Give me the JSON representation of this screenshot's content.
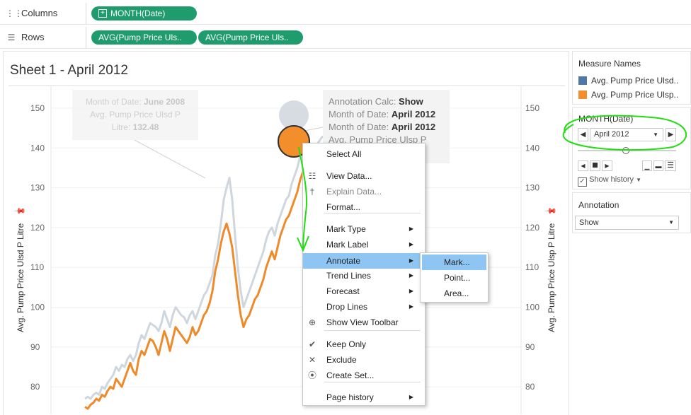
{
  "shelves": {
    "columns_label": "Columns",
    "rows_label": "Rows",
    "columns_pill": "MONTH(Date)",
    "rows_pills": [
      "AVG(Pump Price Uls..",
      "AVG(Pump Price Uls.."
    ]
  },
  "sheet": {
    "title": "Sheet 1 - April 2012",
    "left_axis_title": "Avg. Pump Price Ulsd P Litre",
    "right_axis_title": "Avg. Pump Price Ulsp P Litre",
    "y_ticks": [
      "150",
      "140",
      "130",
      "120",
      "110",
      "100",
      "90",
      "80"
    ]
  },
  "tooltip_faded": {
    "l1_label": "Month of Date:",
    "l1_value": "June 2008",
    "l2_label": "Avg. Pump Price Ulsd P",
    "l2_value": "",
    "l3_label": "Litre:",
    "l3_value": "132.48"
  },
  "tooltip_main": {
    "l1_label": "Annotation Calc:",
    "l1_value": "Show",
    "l2_label": "Month of Date:",
    "l2_value": "April 2012",
    "l3_label": "Month of Date:",
    "l3_value": "April 2012",
    "l4_label": "Avg. Pump Price Ulsp P",
    "l4_value": ""
  },
  "legend": {
    "title": "Measure Names",
    "items": [
      {
        "label": "Avg. Pump Price Ulsd..",
        "color": "#4e79a7"
      },
      {
        "label": "Avg. Pump Price Ulsp..",
        "color": "#f28e2b"
      }
    ]
  },
  "page_control": {
    "title": "MONTH(Date)",
    "value": "April 2012",
    "show_history_label": "Show history",
    "show_history_checked": true,
    "slider_level": 0.48
  },
  "annotation_filter": {
    "title": "Annotation",
    "value": "Show"
  },
  "context_menu": {
    "items": [
      {
        "label": "Select All",
        "icon": "",
        "submenu": false
      },
      {
        "label": "View Data...",
        "icon": "table-icon",
        "submenu": false
      },
      {
        "label": "Explain Data...",
        "icon": "lightbulb-icon",
        "submenu": false,
        "disabled": true
      },
      {
        "label": "Format...",
        "icon": "",
        "submenu": false
      },
      {
        "label": "Mark Type",
        "icon": "",
        "submenu": true
      },
      {
        "label": "Mark Label",
        "icon": "",
        "submenu": true
      },
      {
        "label": "Annotate",
        "icon": "",
        "submenu": true,
        "highlighted": true
      },
      {
        "label": "Trend Lines",
        "icon": "",
        "submenu": true
      },
      {
        "label": "Forecast",
        "icon": "",
        "submenu": true
      },
      {
        "label": "Drop Lines",
        "icon": "",
        "submenu": true
      },
      {
        "label": "Show View Toolbar",
        "icon": "zoom-icon",
        "submenu": false
      },
      {
        "label": "Keep Only",
        "icon": "check-icon",
        "submenu": false
      },
      {
        "label": "Exclude",
        "icon": "x-icon",
        "submenu": false
      },
      {
        "label": "Create Set...",
        "icon": "set-icon",
        "submenu": false
      },
      {
        "label": "Page history",
        "icon": "",
        "submenu": true
      }
    ]
  },
  "annotate_submenu": {
    "items": [
      {
        "label": "Mark...",
        "highlighted": true
      },
      {
        "label": "Point..."
      },
      {
        "label": "Area..."
      }
    ]
  },
  "colors": {
    "pill": "#1e9c6e",
    "ulsd_line": "#cfd6dd",
    "ulsp_line": "#ef8a2b",
    "menu_highlight": "#8ec5f3",
    "marker_pen": "#22dd11"
  },
  "chart_data": {
    "type": "line",
    "title": "Sheet 1 - April 2012",
    "ylabel": "Avg. Pump Price Ulsd P Litre",
    "y2label": "Avg. Pump Price Ulsp P Litre",
    "ylim": [
      75,
      157
    ],
    "series": [
      {
        "name": "Avg. Pump Price Ulsd P Litre",
        "color": "#cfd6dd",
        "values": [
          77,
          77.5,
          77,
          78,
          78.5,
          78,
          80,
          79.5,
          81,
          82,
          83,
          85,
          84,
          85.5,
          85,
          87,
          88,
          86.5,
          88,
          91,
          93,
          92,
          94,
          96,
          95.5,
          95,
          94,
          96,
          99,
          97,
          95,
          98,
          100,
          99,
          98,
          97.5,
          96,
          98,
          99,
          97,
          99,
          101,
          103,
          104,
          106,
          108,
          113,
          116,
          121,
          127,
          130,
          132.5,
          127,
          118,
          110,
          104,
          100,
          102,
          104,
          106,
          108,
          110,
          112,
          114,
          117,
          119,
          120,
          118,
          121,
          123,
          125,
          127,
          128,
          131,
          133,
          135,
          138,
          140,
          141.5,
          140,
          141,
          140.5,
          141,
          142,
          143
        ]
      },
      {
        "name": "Avg. Pump Price Ulsp P Litre",
        "color": "#ef8a2b",
        "values": [
          75,
          74.5,
          75.5,
          76,
          77,
          76.5,
          78,
          77.5,
          79,
          80,
          79.5,
          82,
          81,
          80,
          82,
          84,
          86,
          84,
          83,
          87,
          89,
          88,
          90,
          92,
          91.5,
          90,
          88,
          91,
          94,
          92,
          89,
          92,
          95,
          94,
          93,
          92,
          91,
          92.5,
          95,
          93,
          94,
          96,
          98,
          99,
          101,
          104,
          109,
          112,
          116,
          119,
          121,
          118.5,
          115,
          109,
          103,
          98,
          95,
          97,
          98,
          100,
          102,
          103,
          105,
          107,
          110,
          112,
          114,
          112,
          115,
          118,
          120,
          122,
          123,
          125,
          127,
          129,
          132,
          134,
          136,
          135,
          133,
          136,
          135.5,
          138,
          139
        ]
      }
    ],
    "highlighted_point": {
      "month": "April 2012",
      "series": "Avg. Pump Price Ulsp P Litre",
      "value": 141
    },
    "annotation_point": {
      "month": "June 2008",
      "value": 132.48
    }
  }
}
